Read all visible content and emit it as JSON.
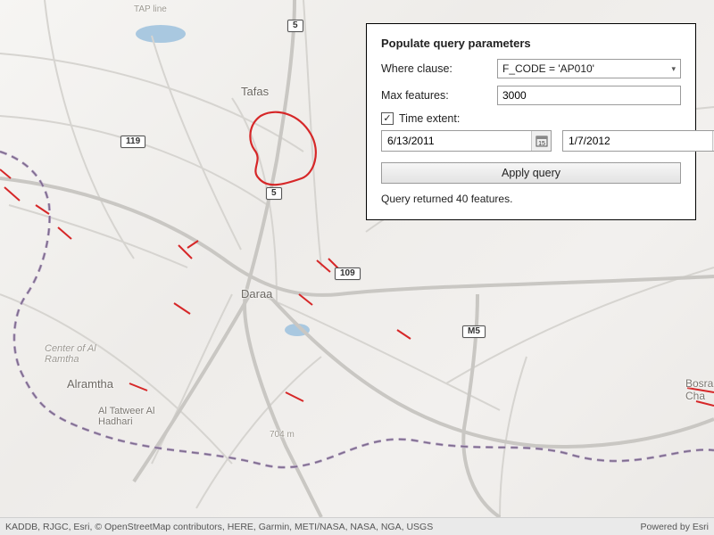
{
  "panel": {
    "title": "Populate query parameters",
    "where_label": "Where clause:",
    "where_value": "F_CODE = 'AP010'",
    "max_features_label": "Max features:",
    "max_features_value": "3000",
    "time_extent_label": "Time extent:",
    "time_extent_checked": true,
    "start_date": "6/13/2011",
    "end_date": "1/7/2012",
    "apply_label": "Apply query",
    "status": "Query returned 40 features."
  },
  "map": {
    "labels": {
      "tafas": "Tafas",
      "daraa": "Daraa",
      "center_al_ramtha": "Center of Al\nRamtha",
      "alramtha": "Alramtha",
      "al_tatweer": "Al Tatweer Al\nHadhari",
      "bosra": "Bosra\nCha",
      "tap_line": "TAP line",
      "elevation_704": "704 m"
    },
    "shields": {
      "route_5a": "5",
      "route_5b": "5",
      "route_119": "119",
      "route_109": "109",
      "route_m5": "M5"
    }
  },
  "footer": {
    "attribution": "KADDB, RJGC, Esri, © OpenStreetMap contributors, HERE, Garmin, METI/NASA, NASA, NGA, USGS",
    "powered": "Powered by Esri"
  }
}
